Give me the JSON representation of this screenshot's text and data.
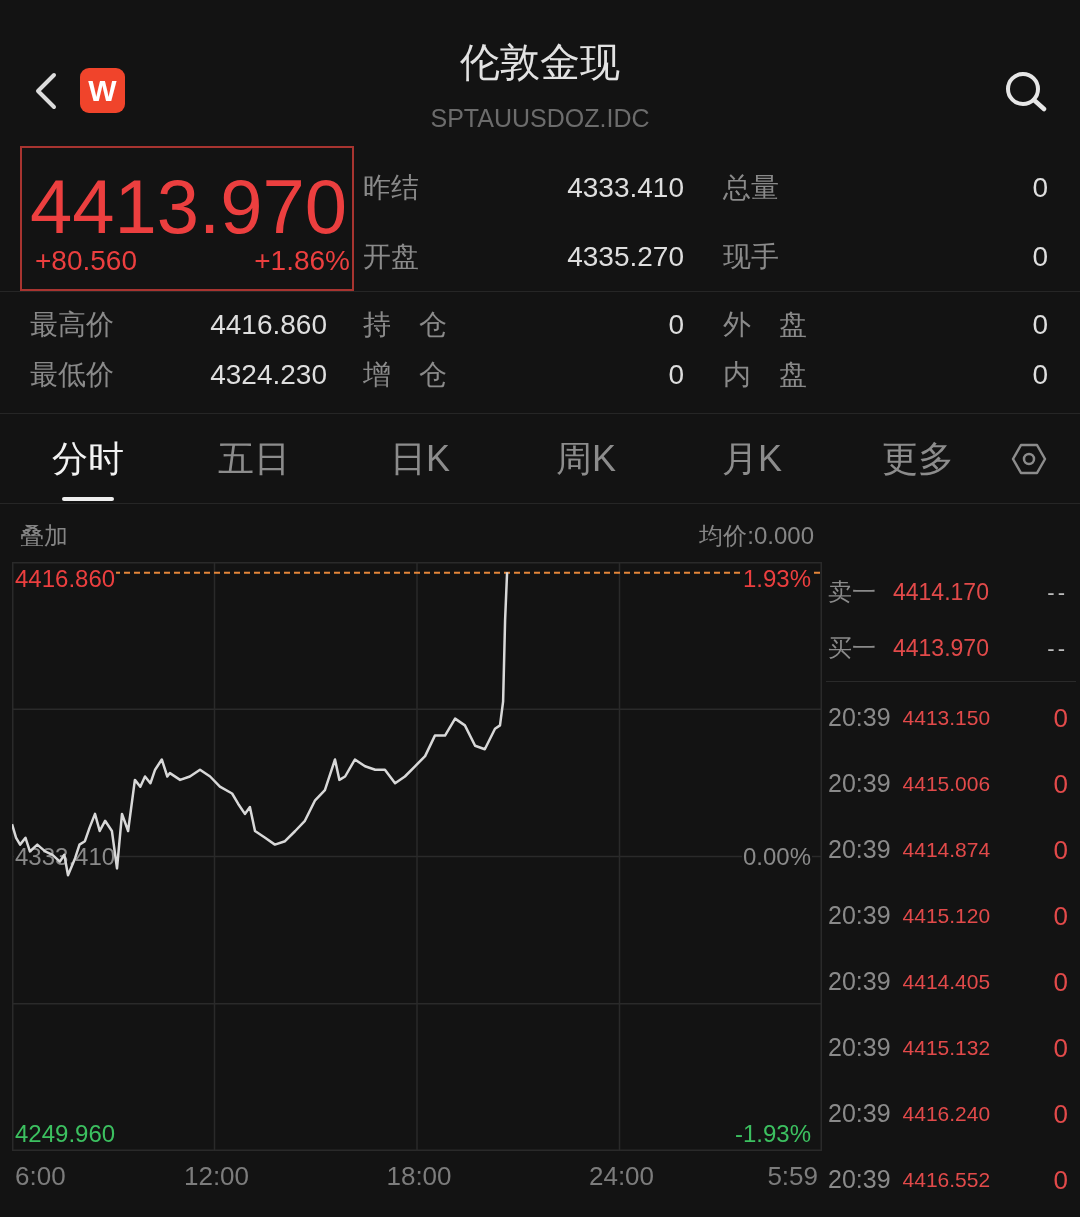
{
  "header": {
    "logo_text": "W",
    "title": "伦敦金现",
    "code": "SPTAUUSDOZ.IDC"
  },
  "price_box": {
    "price": "4413.970",
    "change": "+80.560",
    "change_pct": "+1.86%"
  },
  "quote_rows": [
    [
      {
        "label": "昨结",
        "value": "4333.410"
      },
      {
        "label": "总量",
        "value": "0"
      }
    ],
    [
      {
        "label": "开盘",
        "value": "4335.270"
      },
      {
        "label": "现手",
        "value": "0"
      }
    ]
  ],
  "stats_rows": [
    [
      {
        "label": "最高价",
        "value": "4416.860"
      },
      {
        "label": "持 仓",
        "value": "0"
      },
      {
        "label": "外 盘",
        "value": "0"
      }
    ],
    [
      {
        "label": "最低价",
        "value": "4324.230"
      },
      {
        "label": "增 仓",
        "value": "0"
      },
      {
        "label": "内 盘",
        "value": "0"
      }
    ]
  ],
  "tabs": [
    {
      "label": "分时",
      "selected": true
    },
    {
      "label": "五日",
      "selected": false
    },
    {
      "label": "日K",
      "selected": false
    },
    {
      "label": "周K",
      "selected": false
    },
    {
      "label": "月K",
      "selected": false
    },
    {
      "label": "更多",
      "selected": false
    }
  ],
  "chart_toolbar": {
    "overlay": "叠加",
    "avg_price": "均价:0.000"
  },
  "chart": {
    "percent_labels": [
      "1.93%",
      "0.00%",
      "-1.93%"
    ],
    "end_time_label": "5:59",
    "chart_data": {
      "type": "line",
      "grid": true,
      "xlim": [
        6,
        30
      ],
      "ylim": [
        4247,
        4420
      ],
      "xticks": [
        {
          "value": 6,
          "label": "6:00"
        },
        {
          "value": 12,
          "label": "12:00"
        },
        {
          "value": 18,
          "label": "18:00"
        },
        {
          "value": 24,
          "label": "24:00"
        }
      ],
      "yticks": [
        {
          "value": 4416.86,
          "label": "4416.860"
        },
        {
          "value": 4333.41,
          "label": "4333.410"
        },
        {
          "value": 4249.96,
          "label": "4249.960"
        }
      ],
      "x": [
        6.0,
        6.12,
        6.24,
        6.4,
        6.53,
        6.75,
        6.98,
        7.2,
        7.42,
        7.55,
        7.66,
        7.87,
        8.0,
        8.16,
        8.3,
        8.46,
        8.6,
        8.76,
        8.96,
        9.11,
        9.26,
        9.44,
        9.64,
        9.8,
        9.94,
        10.1,
        10.24,
        10.44,
        10.6,
        10.68,
        10.98,
        11.27,
        11.57,
        11.87,
        12.16,
        12.52,
        12.7,
        12.9,
        13.05,
        13.2,
        13.5,
        13.79,
        14.09,
        14.39,
        14.68,
        14.98,
        15.27,
        15.57,
        15.7,
        15.87,
        16.16,
        16.46,
        16.76,
        17.05,
        17.35,
        17.64,
        17.94,
        18.24,
        18.53,
        18.83,
        19.13,
        19.42,
        19.72,
        20.01,
        20.31,
        20.46,
        20.55,
        20.61,
        20.67
      ],
      "series": [
        {
          "values": [
            4343,
            4339,
            4337,
            4339,
            4335,
            4337,
            4335,
            4334,
            4332,
            4334,
            4328,
            4333,
            4337,
            4338,
            4342,
            4346,
            4341,
            4344,
            4341,
            4330,
            4346,
            4341,
            4356,
            4354,
            4357,
            4355,
            4359,
            4362,
            4357,
            4358,
            4356,
            4357,
            4359,
            4357,
            4354,
            4352,
            4349,
            4346,
            4348,
            4341,
            4339,
            4337,
            4338,
            4341,
            4344,
            4350,
            4353,
            4362,
            4356,
            4357,
            4362,
            4360,
            4359,
            4359,
            4355,
            4357,
            4360,
            4363,
            4369,
            4369,
            4374,
            4372,
            4366,
            4365,
            4371,
            4372,
            4379,
            4403,
            4417
          ]
        }
      ],
      "ref_lines": [
        {
          "axis": "y",
          "value": 4416.86
        }
      ]
    }
  },
  "order_book": [
    {
      "label": "卖一",
      "price": "4414.170",
      "volume": "--"
    },
    {
      "label": "买一",
      "price": "4413.970",
      "volume": "--"
    }
  ],
  "trades": [
    {
      "time": "20:39",
      "price": "4413.150",
      "volume": "0"
    },
    {
      "time": "20:39",
      "price": "4415.006",
      "volume": "0"
    },
    {
      "time": "20:39",
      "price": "4414.874",
      "volume": "0"
    },
    {
      "time": "20:39",
      "price": "4415.120",
      "volume": "0"
    },
    {
      "time": "20:39",
      "price": "4414.405",
      "volume": "0"
    },
    {
      "time": "20:39",
      "price": "4415.132",
      "volume": "0"
    },
    {
      "time": "20:39",
      "price": "4416.240",
      "volume": "0"
    },
    {
      "time": "20:39",
      "price": "4416.552",
      "volume": "0"
    }
  ]
}
